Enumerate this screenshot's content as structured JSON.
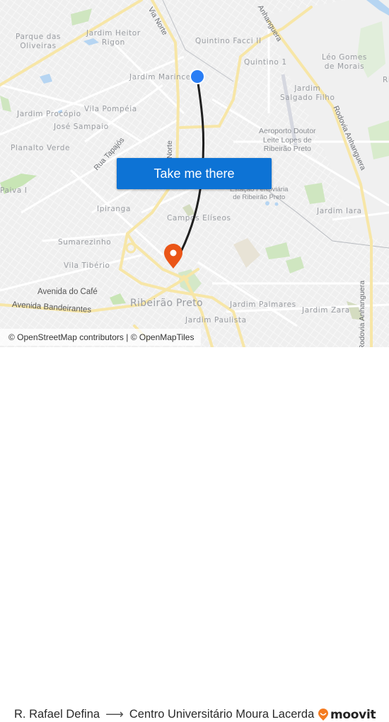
{
  "map": {
    "places": [
      {
        "id": "parque-das-oliveiras",
        "text": "Parque das\nOliveiras"
      },
      {
        "id": "jardim-heitor-rigon",
        "text": "Jardim Heitor\nRigon"
      },
      {
        "id": "quintino-facci-ii",
        "text": "Quintino Facci II"
      },
      {
        "id": "quintino-1",
        "text": "Quintino 1"
      },
      {
        "id": "leo-gomes-de-morais",
        "text": "Léo Gomes\nde Morais"
      },
      {
        "id": "jardim-marincel",
        "text": "Jardim Marincel"
      },
      {
        "id": "jardim-salgado-filho",
        "text": "Jardim\nSalgado Filho"
      },
      {
        "id": "jardim-procopio",
        "text": "Jardim Procópio"
      },
      {
        "id": "vila-pompeia",
        "text": "Vila Pompéia"
      },
      {
        "id": "jose-sampaio",
        "text": "José Sampaio"
      },
      {
        "id": "planalto-verde",
        "text": "Planalto Verde"
      },
      {
        "id": "paiva-i",
        "text": "Paiva I"
      },
      {
        "id": "ipiranga",
        "text": "Ipiranga"
      },
      {
        "id": "campos-eliseos",
        "text": "Campos Elíseos"
      },
      {
        "id": "jardim-iara",
        "text": "Jardim Iara"
      },
      {
        "id": "sumarezinho",
        "text": "Sumarezinho"
      },
      {
        "id": "vila-tiberio",
        "text": "Vila Tibério"
      },
      {
        "id": "ribeirao-preto",
        "text": "Ribeirão Preto"
      },
      {
        "id": "jardim-palmares",
        "text": "Jardim Palmares"
      },
      {
        "id": "jardim-zara",
        "text": "Jardim Zara"
      },
      {
        "id": "jardim-paulista",
        "text": "Jardim Paulista"
      },
      {
        "id": "ri-partial",
        "text": "Ri"
      }
    ],
    "pois": [
      {
        "id": "aeroporto",
        "text": "Aeroporto Doutor\nLeite Lopes de\nRibeirão Preto"
      },
      {
        "id": "estacao",
        "text": "Estação Ferroviária\nde Ribeirão Preto"
      }
    ],
    "roads": [
      {
        "id": "via-norte",
        "text": "Via Norte"
      },
      {
        "id": "via-norte-2",
        "text": "Norte"
      },
      {
        "id": "anhanguera-top",
        "text": "Anhanguera"
      },
      {
        "id": "rodovia-anhanguera",
        "text": "Rodovia Anhanguera"
      },
      {
        "id": "rodovia-anhanguera-bottom",
        "text": "Rodovia Anhanguera"
      },
      {
        "id": "rua-tapajos",
        "text": "Rua Tapajós"
      },
      {
        "id": "avenida-do-cafe",
        "text": "Avenida do Café"
      },
      {
        "id": "avenida-bandeirantes",
        "text": "Avenida Bandeirantes"
      }
    ],
    "origin_marker": {
      "label": "R. Rafael Defina",
      "color": "#2a7ef5"
    },
    "destination_marker": {
      "label": "Centro Universitário Moura Lacerda",
      "color": "#ea5517"
    },
    "route_color": "#1f1f1f",
    "cta_label": "Take me there",
    "attribution": "© OpenStreetMap contributors | © OpenMapTiles"
  },
  "footer": {
    "origin": "R. Rafael Defina",
    "arrow": "⟶",
    "destination": "Centro Universitário Moura Lacerda",
    "brand": "moovit",
    "brand_color": "#f47b20"
  }
}
